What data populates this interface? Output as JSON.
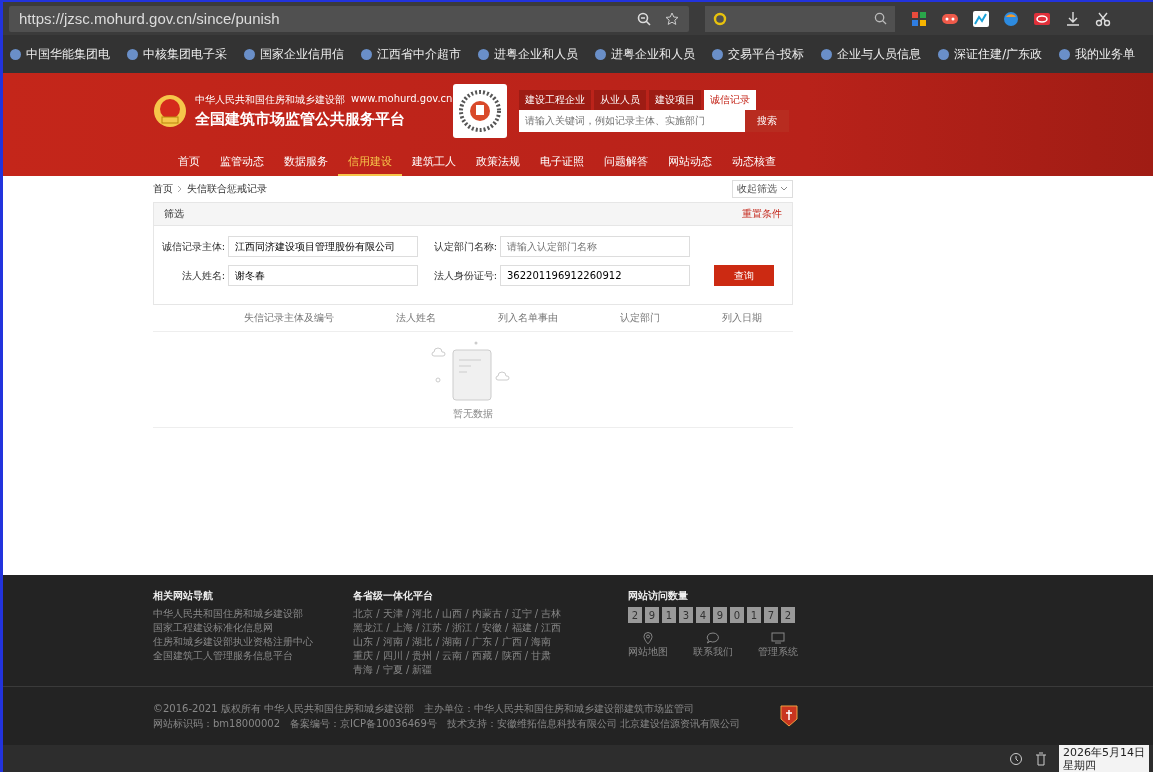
{
  "browser": {
    "url": "https://jzsc.mohurd.gov.cn/since/punish",
    "bookmarks": [
      {
        "label": "中国华能集团电"
      },
      {
        "label": "中核集团电子采"
      },
      {
        "label": "国家企业信用信"
      },
      {
        "label": "江西省中介超市"
      },
      {
        "label": "进粤企业和人员"
      },
      {
        "label": "进粤企业和人员"
      },
      {
        "label": "交易平台-投标"
      },
      {
        "label": "企业与人员信息"
      },
      {
        "label": "深证住建/广东政"
      },
      {
        "label": "我的业务单"
      }
    ]
  },
  "header": {
    "ministry": "中华人民共和国住房和城乡建设部",
    "site_url": "www.mohurd.gov.cn",
    "title": "全国建筑市场监管公共服务平台",
    "search_tabs": [
      {
        "label": "建设工程企业",
        "selected": false
      },
      {
        "label": "从业人员",
        "selected": false
      },
      {
        "label": "建设项目",
        "selected": false
      },
      {
        "label": "诚信记录",
        "selected": true
      }
    ],
    "search": {
      "placeholder": "请输入关键词，例如记录主体、实施部门",
      "button": "搜索"
    }
  },
  "nav": [
    {
      "label": "首页",
      "selected": false
    },
    {
      "label": "监管动态",
      "selected": false
    },
    {
      "label": "数据服务",
      "selected": false
    },
    {
      "label": "信用建设",
      "selected": true
    },
    {
      "label": "建筑工人",
      "selected": false
    },
    {
      "label": "政策法规",
      "selected": false
    },
    {
      "label": "电子证照",
      "selected": false
    },
    {
      "label": "问题解答",
      "selected": false
    },
    {
      "label": "网站动态",
      "selected": false
    },
    {
      "label": "动态核查",
      "selected": false
    }
  ],
  "breadcrumb": [
    "首页",
    "失信联合惩戒记录"
  ],
  "collapse_button": "收起筛选",
  "filter": {
    "title": "筛选",
    "reset": "重置条件",
    "fields": [
      {
        "label": "诚信记录主体:",
        "value": "江西同济建设项目管理股份有限公司"
      },
      {
        "label": "认定部门名称:",
        "placeholder": "请输入认定部门名称"
      },
      {
        "label": "法人姓名:",
        "value": "谢冬春"
      },
      {
        "label": "法人身份证号:",
        "value": "362201196912260912"
      }
    ],
    "query_button": "查询"
  },
  "table": {
    "columns": [
      "失信记录主体及编号",
      "法人姓名",
      "列入名单事由",
      "认定部门",
      "列入日期"
    ],
    "empty_text": "暂无数据"
  },
  "footer": {
    "links_title": "相关网站导航",
    "links": [
      "中华人民共和国住房和城乡建设部",
      "国家工程建设标准化信息网",
      "住房和城乡建设部执业资格注册中心",
      "全国建筑工人管理服务信息平台"
    ],
    "platform_title": "各省级一体化平台",
    "platform_lines": [
      "北京 / 天津 / 河北 / 山西 / 内蒙古 / 辽宁 / 吉林",
      "黑龙江 / 上海 / 江苏 / 浙江 / 安徽 / 福建 / 江西",
      "山东 / 河南 / 湖北 / 湖南 / 广东 / 广西 / 海南",
      "重庆 / 四川 / 贵州 / 云南 / 西藏 / 陕西 / 甘肃",
      "青海 / 宁夏 / 新疆"
    ],
    "visits_title": "网站访问数量",
    "visit_digits": [
      "2",
      "9",
      "1",
      "3",
      "4",
      "9",
      "0",
      "1",
      "7",
      "2"
    ],
    "quick_links": [
      {
        "kind": "map",
        "label": "网站地图"
      },
      {
        "kind": "chat",
        "label": "联系我们"
      },
      {
        "kind": "admin",
        "label": "管理系统"
      }
    ],
    "copyright": "©2016-2021 版权所有 中华人民共和国住房和城乡建设部　主办单位：中华人民共和国住房和城乡建设部建筑市场监管司",
    "icp": "网站标识码：bm18000002　备案编号：京ICP备10036469号　技术支持：安徽维拓信息科技有限公司 北京建设信源资讯有限公司"
  },
  "taskbar": {
    "date": "2026年5月14日",
    "weekday": "星期四"
  }
}
